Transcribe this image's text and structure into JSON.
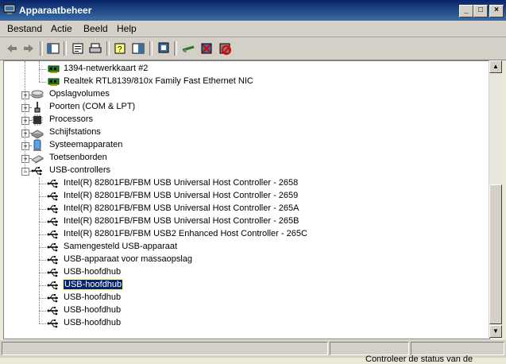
{
  "window": {
    "title": "Apparaatbeheer"
  },
  "menu": [
    "Bestand",
    "Actie",
    "Beeld",
    "Help"
  ],
  "toolbar": [
    "back-icon",
    "forward-icon",
    "console-tree-icon",
    "properties-icon",
    "print-icon",
    "help-icon",
    "show-hide-icon",
    "scan-hardware-icon",
    "update-driver-icon",
    "uninstall-icon",
    "disable-icon"
  ],
  "tree": {
    "rows": [
      {
        "label": "1394-netwerkkaart #2",
        "level": 2,
        "icon": "network-card-icon"
      },
      {
        "label": "Realtek RTL8139/810x Family Fast Ethernet NIC",
        "level": 2,
        "icon": "network-card-icon"
      },
      {
        "label": "Opslagvolumes",
        "level": 1,
        "icon": "storage-volume-icon",
        "expander": "+"
      },
      {
        "label": "Poorten (COM & LPT)",
        "level": 1,
        "icon": "port-icon",
        "expander": "+"
      },
      {
        "label": "Processors",
        "level": 1,
        "icon": "processor-icon",
        "expander": "+"
      },
      {
        "label": "Schijfstations",
        "level": 1,
        "icon": "disk-drive-icon",
        "expander": "+"
      },
      {
        "label": "Systeemapparaten",
        "level": 1,
        "icon": "system-device-icon",
        "expander": "+"
      },
      {
        "label": "Toetsenborden",
        "level": 1,
        "icon": "keyboard-icon",
        "expander": "+"
      },
      {
        "label": "USB-controllers",
        "level": 1,
        "icon": "usb-icon",
        "expander": "−"
      },
      {
        "label": "Intel(R) 82801FB/FBM USB Universal Host Controller - 2658",
        "level": 2,
        "icon": "usb-icon"
      },
      {
        "label": "Intel(R) 82801FB/FBM USB Universal Host Controller - 2659",
        "level": 2,
        "icon": "usb-icon"
      },
      {
        "label": "Intel(R) 82801FB/FBM USB Universal Host Controller - 265A",
        "level": 2,
        "icon": "usb-icon"
      },
      {
        "label": "Intel(R) 82801FB/FBM USB Universal Host Controller - 265B",
        "level": 2,
        "icon": "usb-icon"
      },
      {
        "label": "Intel(R) 82801FB/FBM USB2 Enhanced Host Controller - 265C",
        "level": 2,
        "icon": "usb-icon"
      },
      {
        "label": "Samengesteld USB-apparaat",
        "level": 2,
        "icon": "usb-icon"
      },
      {
        "label": "USB-apparaat voor massaopslag",
        "level": 2,
        "icon": "usb-icon"
      },
      {
        "label": "USB-hoofdhub",
        "level": 2,
        "icon": "usb-icon"
      },
      {
        "label": "USB-hoofdhub",
        "level": 2,
        "icon": "usb-icon",
        "selected": true
      },
      {
        "label": "USB-hoofdhub",
        "level": 2,
        "icon": "usb-icon"
      },
      {
        "label": "USB-hoofdhub",
        "level": 2,
        "icon": "usb-icon"
      },
      {
        "label": "USB-hoofdhub",
        "level": 2,
        "icon": "usb-icon"
      }
    ]
  },
  "background_text": "Controleer de status van de",
  "colors": {
    "titlebar": "#0a246a",
    "selection": "#0a246a",
    "face": "#d4d0c8"
  }
}
